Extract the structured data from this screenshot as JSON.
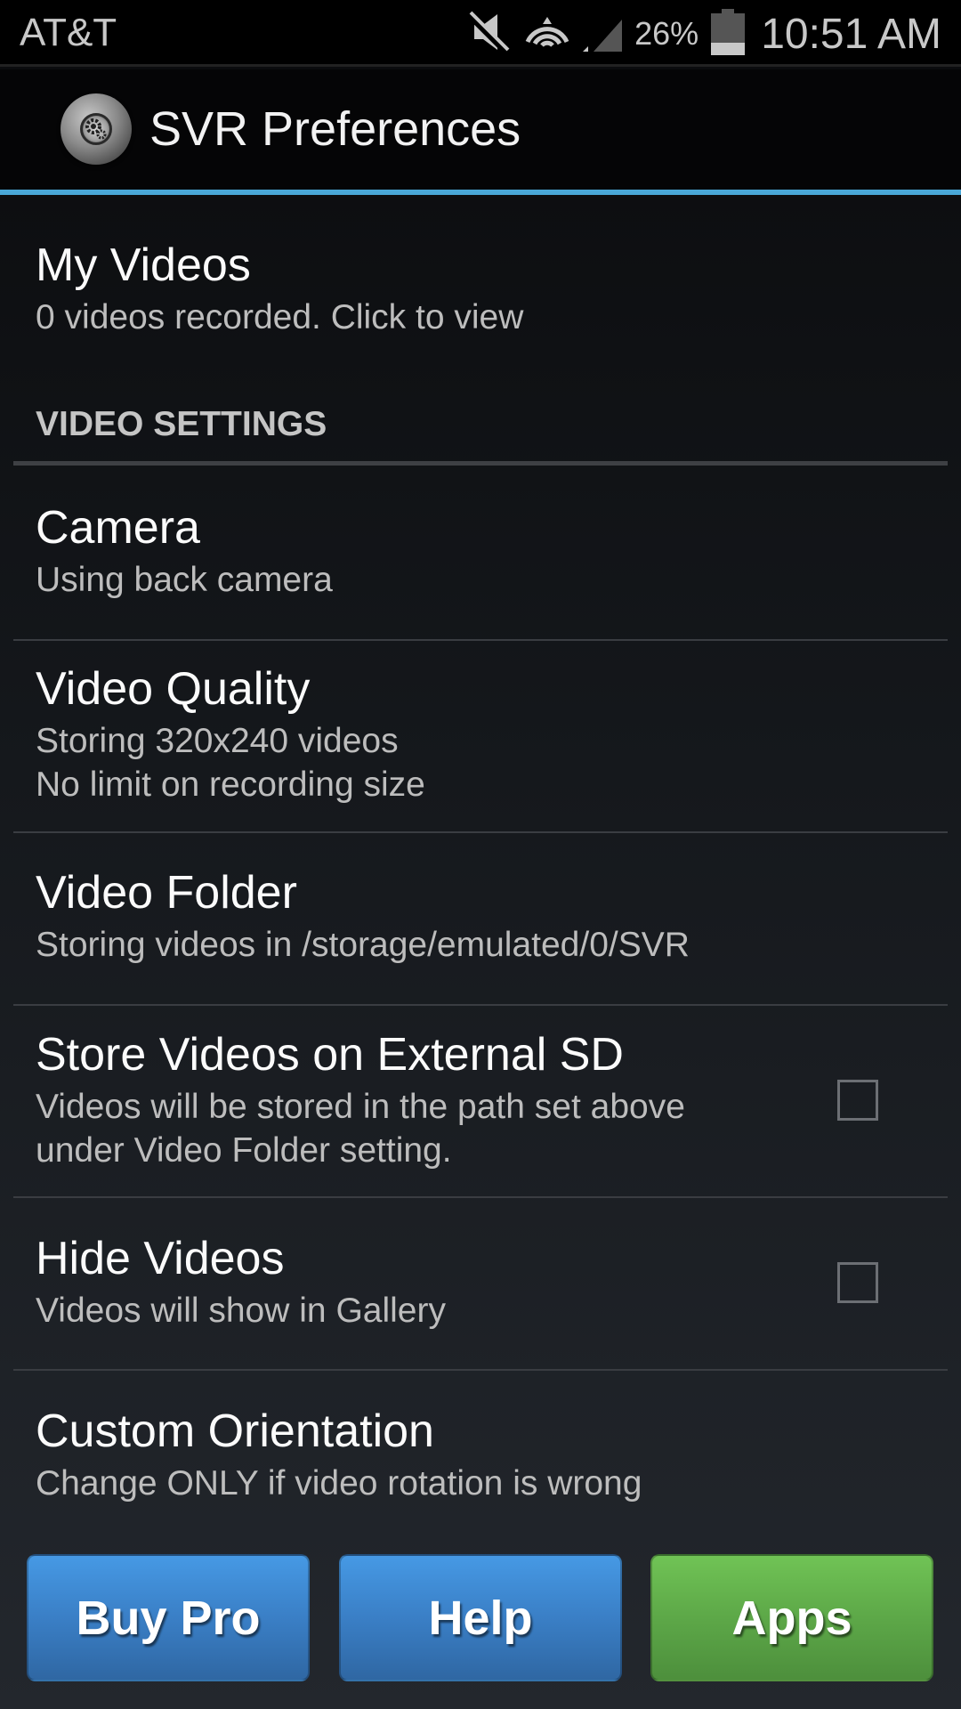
{
  "status_bar": {
    "carrier": "AT&T",
    "icons": [
      "mute-icon",
      "wifi-hotspot-icon",
      "signal-icon",
      "battery-icon"
    ],
    "battery_percent": "26%",
    "battery_level": 0.26,
    "time": "10:51 AM"
  },
  "action_bar": {
    "title": "SVR Preferences",
    "icon": "app-gear-lens-icon",
    "accent_color": "#4aa8d8"
  },
  "preferences": {
    "my_videos": {
      "title": "My Videos",
      "summary": "0 videos recorded. Click to view"
    },
    "category_video_settings": "VIDEO SETTINGS",
    "camera": {
      "title": "Camera",
      "summary": "Using back camera"
    },
    "video_quality": {
      "title": "Video Quality",
      "summary_line1": "Storing 320x240 videos",
      "summary_line2": "No limit on recording size"
    },
    "video_folder": {
      "title": "Video Folder",
      "summary": "Storing videos in /storage/emulated/0/SVR"
    },
    "external_sd": {
      "title": "Store Videos on External SD",
      "summary_line1": "Videos will be stored in the path set above",
      "summary_line2": "under Video Folder setting.",
      "checked": false
    },
    "hide_videos": {
      "title": "Hide Videos",
      "summary": "Videos will show in Gallery",
      "checked": false
    },
    "custom_orientation": {
      "title": "Custom Orientation",
      "summary": "Change ONLY if video rotation is wrong"
    }
  },
  "buttons": {
    "buy_pro": {
      "label": "Buy Pro",
      "color": "#3a7fc6"
    },
    "help": {
      "label": "Help",
      "color": "#3a7fc6"
    },
    "apps": {
      "label": "Apps",
      "color": "#5da848"
    }
  }
}
